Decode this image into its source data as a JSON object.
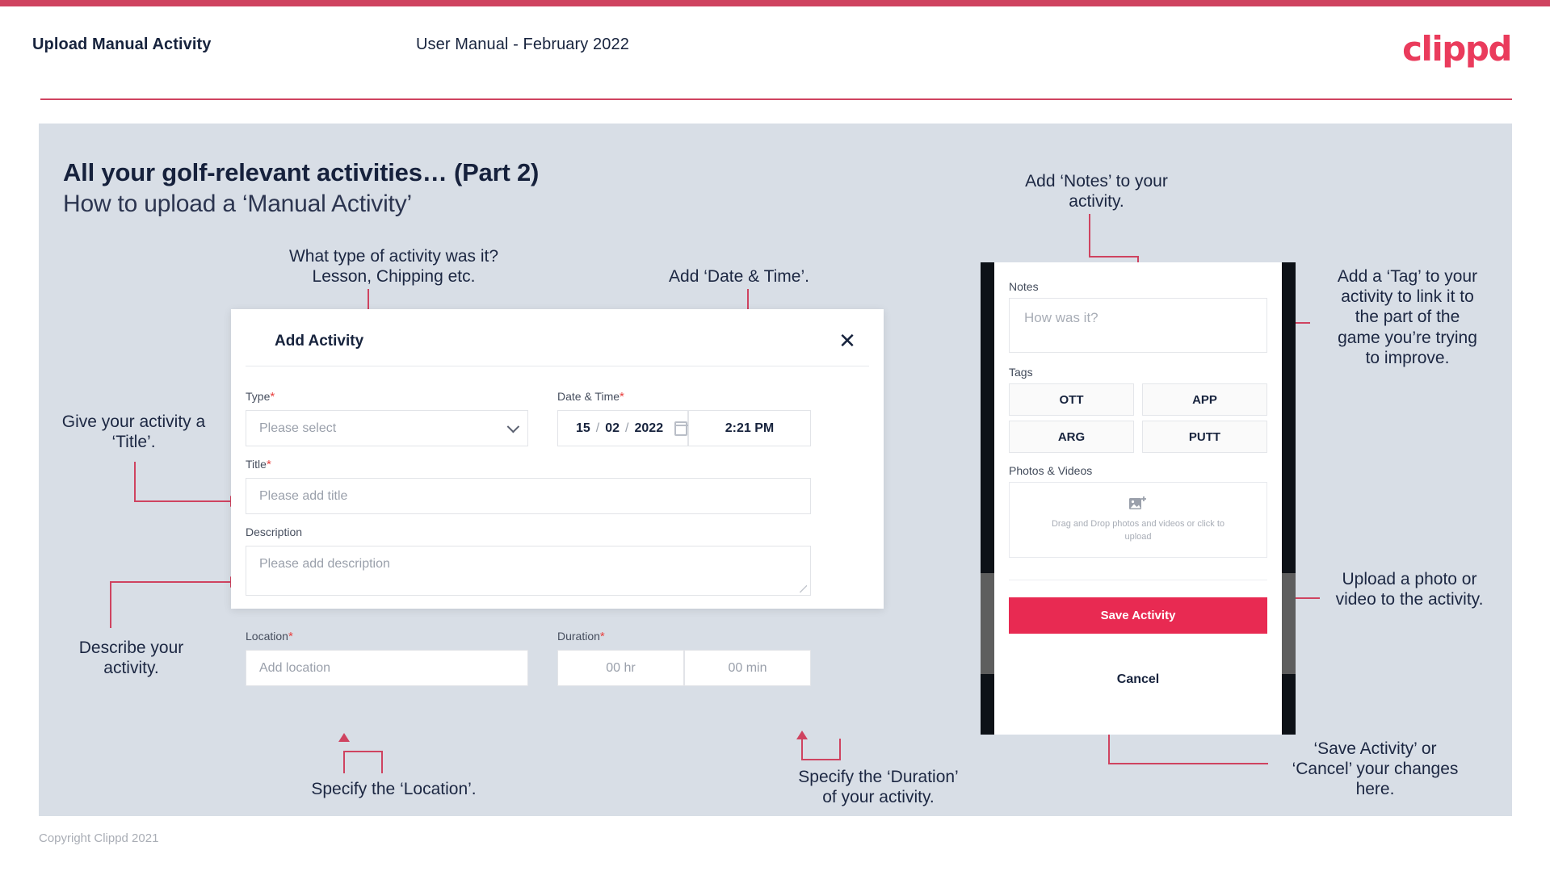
{
  "header": {
    "title": "Upload Manual Activity",
    "subtitle": "User Manual - February 2022",
    "logo": "clippd"
  },
  "slide": {
    "heading": "All your golf-relevant activities… (Part 2)",
    "subheading": "How to upload a ‘Manual Activity’"
  },
  "annotations": {
    "type": "What type of activity was it?\nLesson, Chipping etc.",
    "datetime": "Add ‘Date & Time’.",
    "title": "Give your activity a\n‘Title’.",
    "description": "Describe your\nactivity.",
    "location": "Specify the ‘Location’.",
    "duration": "Specify the ‘Duration’\nof your activity.",
    "notes": "Add ‘Notes’ to your\nactivity.",
    "tags": "Add a ‘Tag’ to your\nactivity to link it to\nthe part of the\ngame you’re trying\nto improve.",
    "upload": "Upload a photo or\nvideo to the activity.",
    "save": "‘Save Activity’ or\n‘Cancel’ your changes\nhere."
  },
  "dialog": {
    "title": "Add Activity",
    "close_icon": "close-icon",
    "fields": {
      "type": {
        "label": "Type",
        "required": "*",
        "placeholder": "Please select"
      },
      "datetime": {
        "label": "Date & Time",
        "required": "*",
        "day": "15",
        "month": "02",
        "year": "2022",
        "sep": "/",
        "time": "2:21 PM"
      },
      "title": {
        "label": "Title",
        "required": "*",
        "placeholder": "Please add title"
      },
      "description": {
        "label": "Description",
        "required": "",
        "placeholder": "Please add description"
      },
      "location": {
        "label": "Location",
        "required": "*",
        "placeholder": "Add location"
      },
      "duration": {
        "label": "Duration",
        "required": "*",
        "hours": "00 hr",
        "minutes": "00 min"
      }
    }
  },
  "phone": {
    "notes": {
      "label": "Notes",
      "placeholder": "How was it?"
    },
    "tags_label": "Tags",
    "tags": [
      "OTT",
      "APP",
      "ARG",
      "PUTT"
    ],
    "photos": {
      "label": "Photos & Videos",
      "drop_text": "Drag and Drop photos and videos or click to upload"
    },
    "save_label": "Save Activity",
    "cancel_label": "Cancel"
  },
  "footer": {
    "copyright": "Copyright Clippd 2021"
  },
  "colors": {
    "accent": "#cf4360",
    "brand": "#ea3b5c",
    "save": "#e82a52",
    "slide_bg": "#d8dee6",
    "text": "#17233d"
  }
}
